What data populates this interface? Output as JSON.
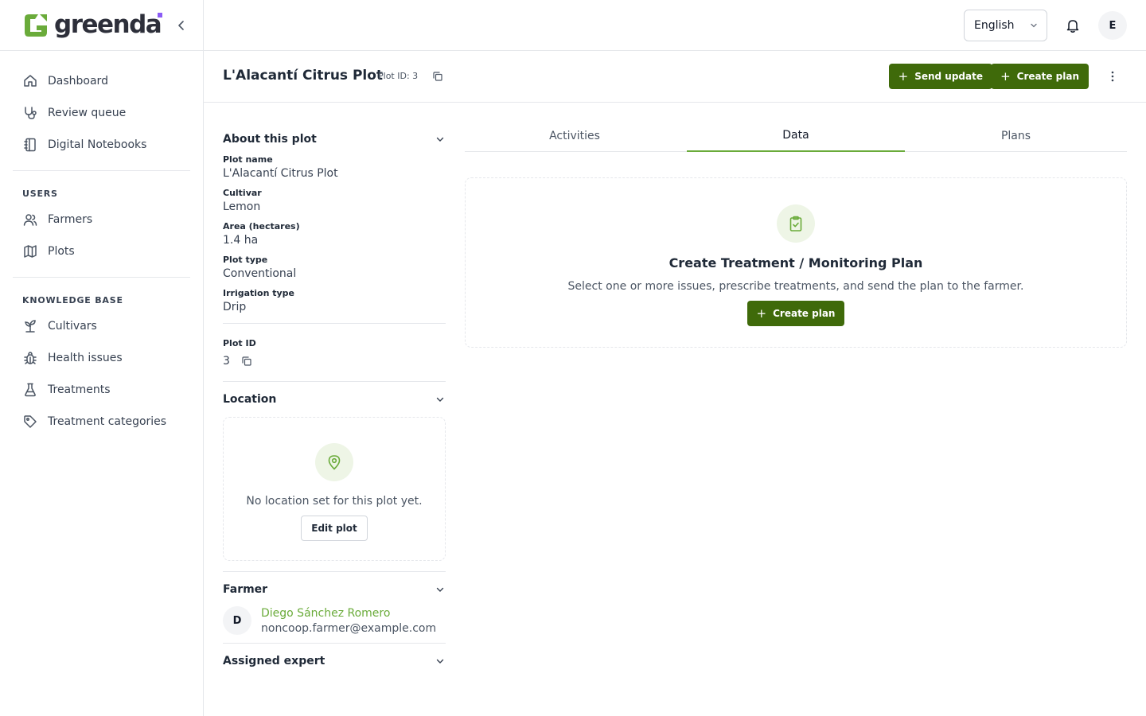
{
  "brand": {
    "name": "greenda",
    "accent": "#6aab3a",
    "primary_button": "#3f6a0a",
    "dot_color": "#8b5cf6"
  },
  "sidebar": {
    "main_items": [
      {
        "label": "Dashboard",
        "icon": "home-icon"
      },
      {
        "label": "Review queue",
        "icon": "stethoscope-icon"
      },
      {
        "label": "Digital Notebooks",
        "icon": "notebook-icon"
      }
    ],
    "users_heading": "USERS",
    "users_items": [
      {
        "label": "Farmers",
        "icon": "users-icon"
      },
      {
        "label": "Plots",
        "icon": "map-icon"
      }
    ],
    "kb_heading": "KNOWLEDGE BASE",
    "kb_items": [
      {
        "label": "Cultivars",
        "icon": "sprout-icon"
      },
      {
        "label": "Health issues",
        "icon": "bug-icon"
      },
      {
        "label": "Treatments",
        "icon": "flask-icon"
      },
      {
        "label": "Treatment categories",
        "icon": "tag-icon"
      }
    ]
  },
  "topbar": {
    "language": "English",
    "user_initial": "E"
  },
  "header": {
    "title": "L'Alacantí Citrus Plot",
    "plot_id_tag": "Plot ID: 3",
    "send_update_label": "Send update",
    "create_plan_label": "Create plan"
  },
  "about": {
    "heading": "About this plot",
    "fields": [
      {
        "label": "Plot name",
        "value": "L'Alacantí Citrus Plot"
      },
      {
        "label": "Cultivar",
        "value": "Lemon"
      },
      {
        "label": "Area (hectares)",
        "value": "1.4 ha"
      },
      {
        "label": "Plot type",
        "value": "Conventional"
      },
      {
        "label": "Irrigation type",
        "value": "Drip"
      }
    ],
    "plot_id_label": "Plot ID",
    "plot_id_value": "3"
  },
  "location": {
    "heading": "Location",
    "empty_text": "No location set for this plot yet.",
    "edit_label": "Edit plot"
  },
  "farmer": {
    "heading": "Farmer",
    "initial": "D",
    "name": "Diego Sánchez Romero",
    "email": "noncoop.farmer@example.com"
  },
  "expert": {
    "heading": "Assigned expert"
  },
  "tabs": [
    {
      "label": "Activities",
      "active": false
    },
    {
      "label": "Data",
      "active": true
    },
    {
      "label": "Plans",
      "active": false
    }
  ],
  "plan_card": {
    "title": "Create Treatment / Monitoring Plan",
    "description": "Select one or more issues, prescribe treatments, and send the plan to the farmer.",
    "button_label": "Create plan"
  }
}
